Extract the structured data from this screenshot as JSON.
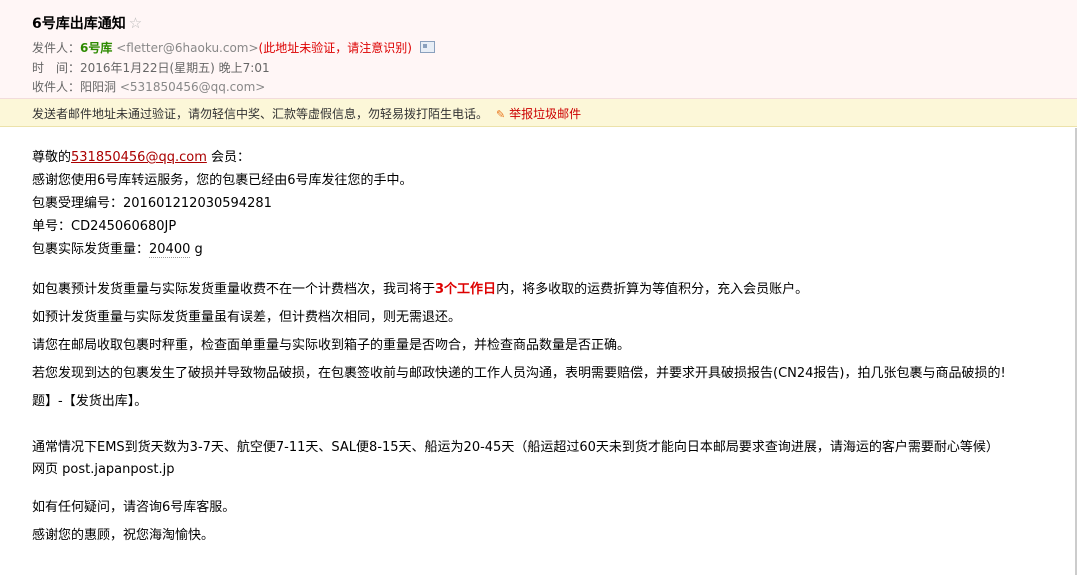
{
  "email": {
    "subject": "6号库出库通知",
    "star_icon": "star-icon",
    "from_label": "发件人：",
    "from_name": "6号库",
    "from_addr": "<fletter@6haoku.com>",
    "from_warn": "(此地址未验证，请注意识别)",
    "time_label": "时　间：",
    "time_value": "2016年1月22日(星期五) 晚上7:01",
    "to_label": "收件人：",
    "to_name": "阳阳洞",
    "to_addr": "<531850456@qq.com>"
  },
  "warning": {
    "text": "发送者邮件地址未通过验证，请勿轻信中奖、汇款等虚假信息，勿轻易拨打陌生电话。",
    "report": "举报垃圾邮件"
  },
  "body": {
    "greet_pre": "尊敬的",
    "greet_link": "531850456@qq.com",
    "greet_post": " 会员：",
    "l2": "感谢您使用6号库转运服务，您的包裹已经由6号库发往您的手中。",
    "l3": "包裹受理编号：201601212030594281",
    "l4": "单号：CD245060680JP",
    "l5_pre": "包裹实际发货重量：",
    "l5_val": "20400",
    "l5_unit": " g",
    "p1_pre": "如包裹预计发货重量与实际发货重量收费不在一个计费档次，我司将于",
    "p1_bold": "3个工作日",
    "p1_post": "内，将多收取的运费折算为等值积分，充入会员账户。",
    "p2": "如预计发货重量与实际发货重量虽有误差，但计费档次相同，则无需退还。",
    "p3": "请您在邮局收取包裹时秤重，检查面单重量与实际收到箱子的重量是否吻合，并检查商品数量是否正确。",
    "p4": "若您发现到达的包裹发生了破损并导致物品破损，在包裹签收前与邮政快递的工作人员沟通，表明需要赔偿，并要求开具破损报告(CN24报告)，拍几张包裹与商品破损的!",
    "p5": "题】-【发货出库】。",
    "p6": "通常情况下EMS到货天数为3-7天、航空便7-11天、SAL便8-15天、船运为20-45天（船运超过60天未到货才能向日本邮局要求查询进展，请海运的客户需要耐心等候）",
    "p7": "网页 post.japanpost.jp",
    "p8": "如有任何疑问，请咨询6号库客服。",
    "p9": "感谢您的惠顾，祝您海淘愉快。"
  }
}
